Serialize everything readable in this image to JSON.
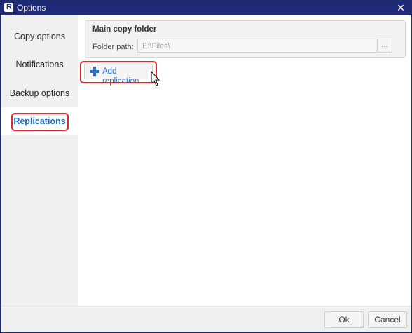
{
  "window": {
    "title": "Options",
    "app_icon_letter": "R",
    "close_glyph": "✕"
  },
  "sidebar": {
    "items": [
      {
        "label": "Copy options",
        "active": false
      },
      {
        "label": "Notifications",
        "active": false
      },
      {
        "label": "Backup options",
        "active": false
      },
      {
        "label": "Replications",
        "active": true
      }
    ]
  },
  "main_folder": {
    "title": "Main copy folder",
    "folder_label": "Folder path:",
    "folder_value": "E:\\Files\\",
    "browse_label": "..."
  },
  "replication": {
    "add_label": "Add replication"
  },
  "footer": {
    "ok_label": "Ok",
    "cancel_label": "Cancel"
  },
  "colors": {
    "titlebar": "#1e2a78",
    "accent": "#1c6fc4",
    "highlight": "#e0262b"
  }
}
